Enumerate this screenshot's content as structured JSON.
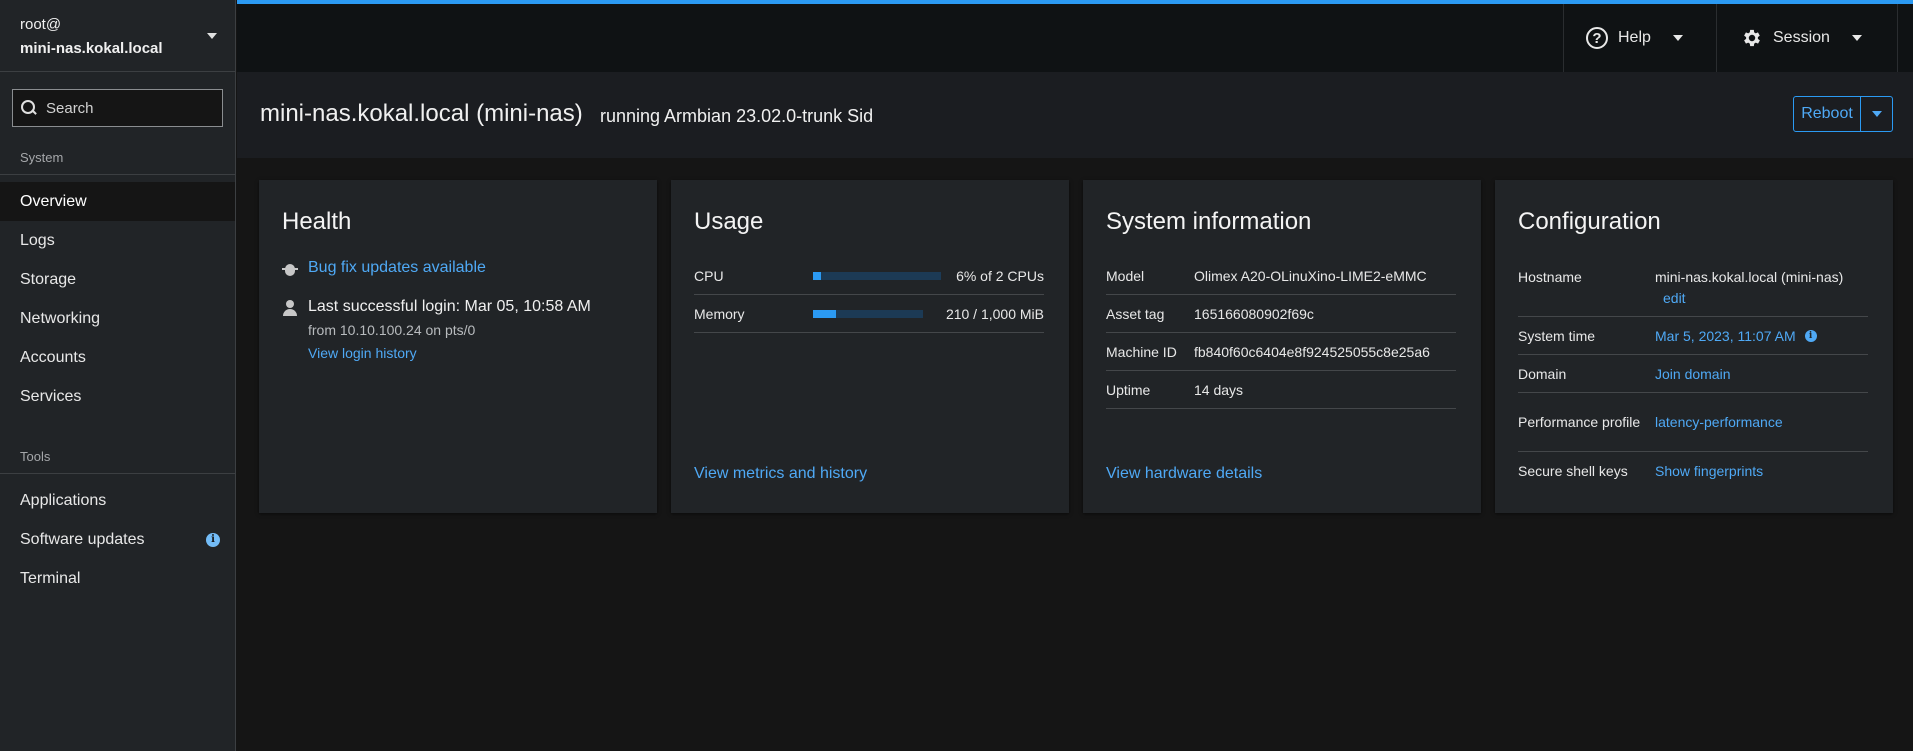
{
  "sidebar": {
    "user": "root@",
    "host": "mini-nas.kokal.local",
    "search_placeholder": "Search",
    "system_title": "System",
    "system_items": [
      {
        "label": "Overview",
        "active": true
      },
      {
        "label": "Logs"
      },
      {
        "label": "Storage"
      },
      {
        "label": "Networking"
      },
      {
        "label": "Accounts"
      },
      {
        "label": "Services"
      }
    ],
    "tools_title": "Tools",
    "tools_items": [
      {
        "label": "Applications"
      },
      {
        "label": "Software updates",
        "badge": "i"
      },
      {
        "label": "Terminal"
      }
    ]
  },
  "topbar": {
    "help_label": "Help",
    "session_label": "Session",
    "accent_color": "#2b9af3"
  },
  "header": {
    "title": "mini-nas.kokal.local (mini-nas)",
    "subtitle": "running Armbian 23.02.0-trunk Sid",
    "reboot_label": "Reboot"
  },
  "health": {
    "title": "Health",
    "bug_link": "Bug fix updates available",
    "login_text": "Last successful login: Mar 05, 10:58 AM",
    "login_from": "from 10.10.100.24 on pts/0",
    "login_history_link": "View login history"
  },
  "usage": {
    "title": "Usage",
    "cpu_label": "CPU",
    "cpu_value": "6% of 2 CPUs",
    "cpu_fraction": 0.06,
    "memory_label": "Memory",
    "memory_value": "210 / 1,000 MiB",
    "memory_fraction": 0.21,
    "footer_link": "View metrics and history"
  },
  "sysinfo": {
    "title": "System information",
    "rows": [
      {
        "key": "Model",
        "value": "Olimex A20-OLinuXino-LIME2-eMMC"
      },
      {
        "key": "Asset tag",
        "value": "165166080902f69c"
      },
      {
        "key": "Machine ID",
        "value": "fb840f60c6404e8f924525055c8e25a6"
      },
      {
        "key": "Uptime",
        "value": "14 days"
      }
    ],
    "footer_link": "View hardware details"
  },
  "config": {
    "title": "Configuration",
    "hostname_label": "Hostname",
    "hostname_value": "mini-nas.kokal.local (mini-nas)",
    "hostname_edit": "edit",
    "systime_label": "System time",
    "systime_value": "Mar 5, 2023, 11:07 AM",
    "domain_label": "Domain",
    "domain_value": "Join domain",
    "perf_label": "Performance profile",
    "perf_value": "latency-performance",
    "ssh_label": "Secure shell keys",
    "ssh_value": "Show fingerprints"
  }
}
